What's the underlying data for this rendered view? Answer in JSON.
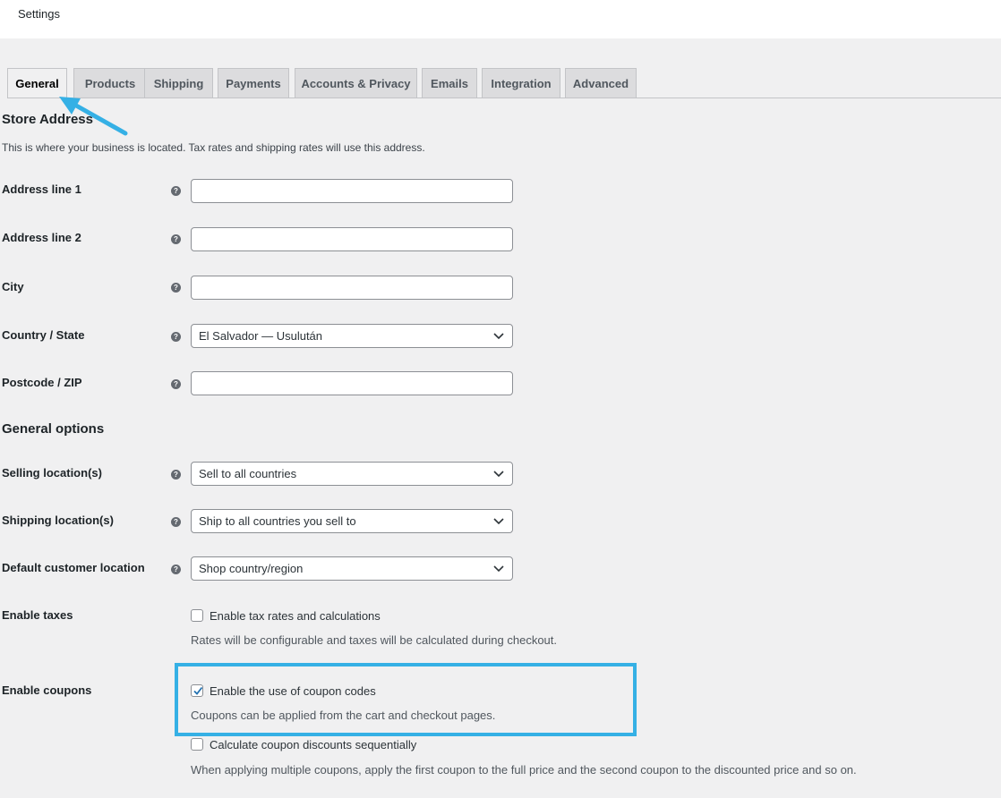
{
  "header": {
    "title": "Settings"
  },
  "tabs": [
    {
      "label": "General",
      "active": true
    },
    {
      "label": "Products"
    },
    {
      "label": "Shipping"
    },
    {
      "label": "Payments"
    },
    {
      "label": "Accounts & Privacy"
    },
    {
      "label": "Emails"
    },
    {
      "label": "Integration"
    },
    {
      "label": "Advanced"
    }
  ],
  "store_address": {
    "heading": "Store Address",
    "description": "This is where your business is located. Tax rates and shipping rates will use this address.",
    "address1": {
      "label": "Address line 1",
      "value": ""
    },
    "address2": {
      "label": "Address line 2",
      "value": ""
    },
    "city": {
      "label": "City",
      "value": ""
    },
    "country": {
      "label": "Country / State",
      "value": "El Salvador — Usulután"
    },
    "postcode": {
      "label": "Postcode / ZIP",
      "value": ""
    }
  },
  "general_options": {
    "heading": "General options",
    "selling": {
      "label": "Selling location(s)",
      "value": "Sell to all countries"
    },
    "shipping": {
      "label": "Shipping location(s)",
      "value": "Ship to all countries you sell to"
    },
    "default_location": {
      "label": "Default customer location",
      "value": "Shop country/region"
    },
    "taxes": {
      "label": "Enable taxes",
      "checkbox_label": "Enable tax rates and calculations",
      "checked": false,
      "help": "Rates will be configurable and taxes will be calculated during checkout."
    },
    "coupons": {
      "label": "Enable coupons",
      "checkbox_label": "Enable the use of coupon codes",
      "checked": true,
      "help": "Coupons can be applied from the cart and checkout pages.",
      "sequential_label": "Calculate coupon discounts sequentially",
      "sequential_checked": false,
      "sequential_help": "When applying multiple coupons, apply the first coupon to the full price and the second coupon to the discounted price and so on."
    }
  },
  "help_icon_glyph": "?",
  "colors": {
    "highlight": "#35b0e5",
    "arrow": "#35b0e5",
    "background": "#f0f0f1"
  }
}
